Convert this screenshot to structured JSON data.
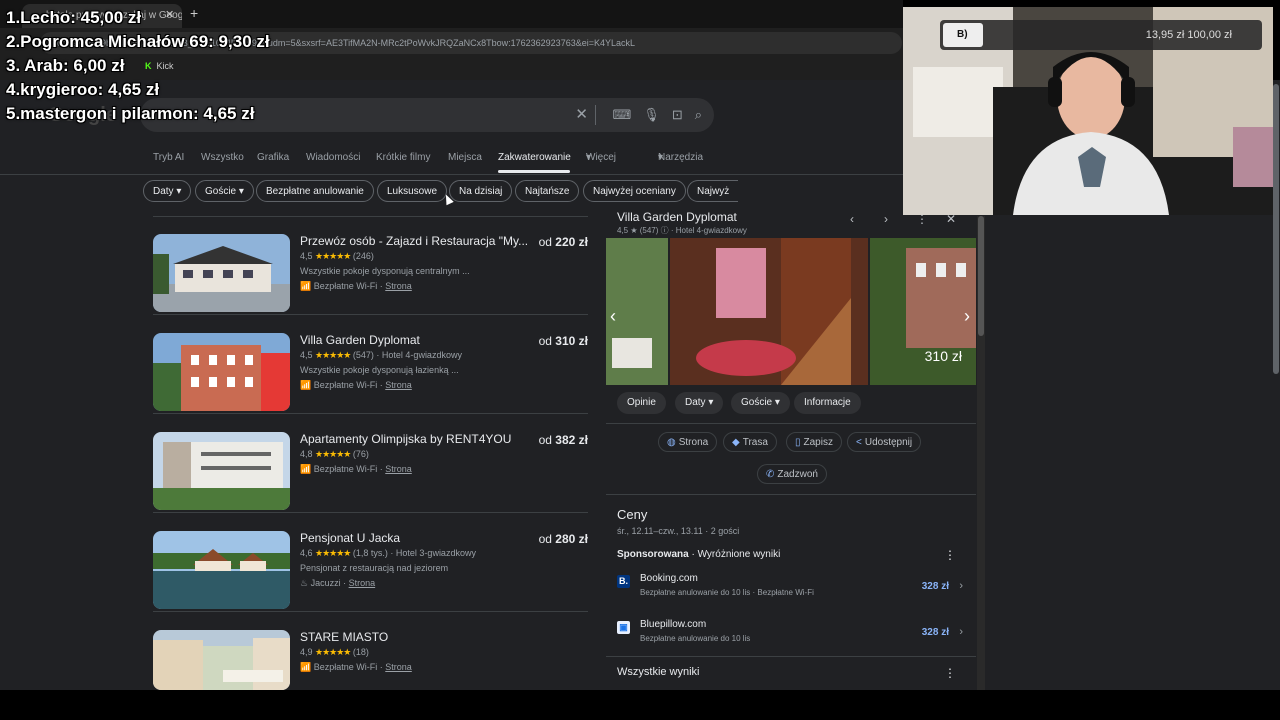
{
  "browser": {
    "tab_title": "hotele pulawy - Szukaj w Google",
    "url": "0cb097f5cf89beeb&rlz=1C1VDKB_plPL1094PL1094&udm=5&sxsrf=AE3TifMA2N-MRc2tPoWvkJRQZaNCx8Tbow:1762362923763&ei=K4YLackL",
    "bookmark_kick": "Kick"
  },
  "search": {
    "logo": "Google",
    "query": ""
  },
  "nav": {
    "tabs": [
      "Tryb AI",
      "Wszystko",
      "Grafika",
      "Wiadomości",
      "Krótkie filmy",
      "Miejsca",
      "Zakwaterowanie",
      "Więcej",
      "Narzędzia"
    ],
    "active": "Zakwaterowanie"
  },
  "filters": [
    "Daty",
    "Goście",
    "Bezpłatne anulowanie",
    "Luksusowe",
    "Na dzisiaj",
    "Najtańsze",
    "Najwyżej oceniany",
    "Najwyż"
  ],
  "results": [
    {
      "name": "Przewóz osób - Zajazd i Restauracja \"My...",
      "price_prefix": "od",
      "price": "220 zł",
      "rating": "4,5",
      "stars": "★★★★★",
      "reviews": "(246)",
      "category": "",
      "desc": "Wszystkie pokoje dysponują centralnym ...",
      "amenity": "Bezpłatne Wi-Fi",
      "link": "Strona"
    },
    {
      "name": "Villa Garden Dyplomat",
      "price_prefix": "od",
      "price": "310 zł",
      "rating": "4,5",
      "stars": "★★★★★",
      "reviews": "(547)",
      "category": "· Hotel 4-gwiazdkowy",
      "desc": "Wszystkie pokoje dysponują łazienką ...",
      "amenity": "Bezpłatne Wi-Fi",
      "link": "Strona"
    },
    {
      "name": "Apartamenty Olimpijska by RENT4YOU",
      "price_prefix": "od",
      "price": "382 zł",
      "rating": "4,8",
      "stars": "★★★★★",
      "reviews": "(76)",
      "category": "",
      "desc": "",
      "amenity": "Bezpłatne Wi-Fi",
      "link": "Strona"
    },
    {
      "name": "Pensjonat U Jacka",
      "price_prefix": "od",
      "price": "280 zł",
      "rating": "4,6",
      "stars": "★★★★★",
      "reviews": "(1,8 tys.)",
      "category": "· Hotel 3-gwiazdkowy",
      "desc": "Pensjonat z restauracją nad jeziorem",
      "amenity": "Jacuzzi",
      "link": "Strona"
    },
    {
      "name": "STARE MIASTO",
      "price_prefix": "",
      "price": "",
      "rating": "4,9",
      "stars": "★★★★★",
      "reviews": "(18)",
      "category": "",
      "desc": "",
      "amenity": "Bezpłatne Wi-Fi",
      "link": "Strona"
    }
  ],
  "panel": {
    "title": "Villa Garden Dyplomat",
    "subtitle": "4,5 ★ (547) ⓘ · Hotel 4-gwiazdkowy",
    "gallery_price": "310 zł",
    "tabs": [
      "Opinie",
      "Daty",
      "Goście",
      "Informacje"
    ],
    "actions": [
      "Strona",
      "Trasa",
      "Zapisz",
      "Udostępnij"
    ],
    "call": "Zadzwoń",
    "prices_title": "Ceny",
    "dates": "śr., 12.11–czw., 13.11 · 2 gości",
    "sponsored_label": "Sponsorowana",
    "sponsored_text": " · Wyróżnione wyniki",
    "providers": [
      {
        "name": "Booking.com",
        "note": "Bezpłatne anulowanie do 10 lis · Bezpłatne Wi-Fi",
        "price": "328 zł",
        "logo": "B.",
        "color": "#003580"
      },
      {
        "name": "Bluepillow.com",
        "note": "Bezpłatne anulowanie do 10 lis",
        "price": "328 zł",
        "logo": "▣",
        "color": "#1a73e8"
      }
    ],
    "all_results": "Wszystkie wyniki"
  },
  "webcam": {
    "badge": "B)",
    "amount": "13,95 zł  100,00 zł"
  },
  "overlay": [
    "1.Lecho: 45,00 zł",
    "2.Pogromca Michałów 69: 9,30 zł",
    "3. Arab: 6,00 zł",
    "4.krygieroo: 4,65 zł",
    "5.mastergon i pilarmon: 4,65 zł"
  ]
}
